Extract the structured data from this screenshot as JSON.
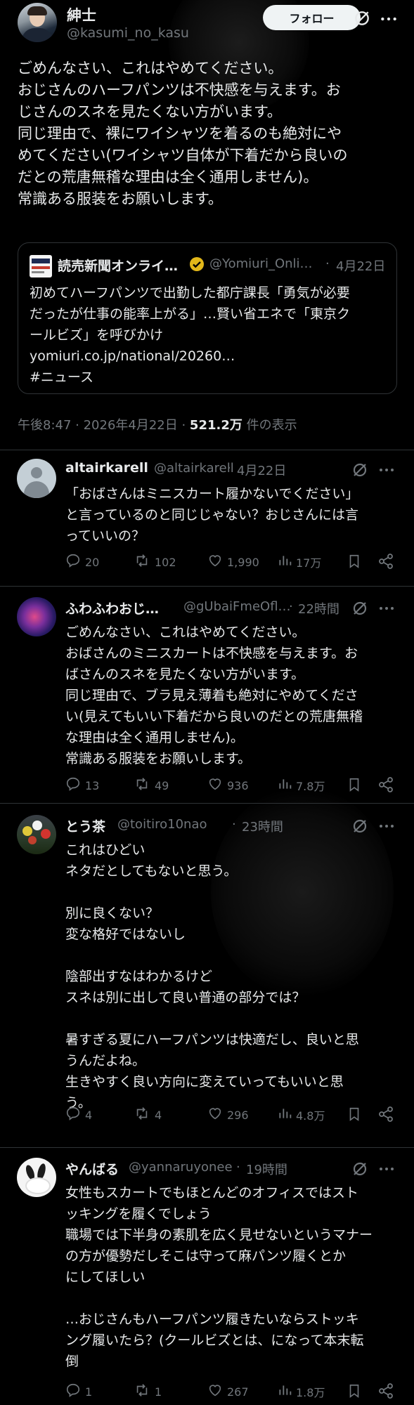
{
  "tweet": {
    "author_name": "紳士",
    "author_handle": "@kasumi_no_kasu",
    "follow_label": "フォロー",
    "text": "ごめんなさい、これはやめてください。\nおじさんのハーフパンツは不快感を与えます。お\nじさんのスネを見たくない方がいます。\n同じ理由で、裸にワイシャツを着るのも絶対にや\nめてください(ワイシャツ自体が下着だから良いの\nだとの荒唐無稽な理由は全く通用しません)。\n常識ある服装をお願いします。",
    "quote": {
      "source_name": "読売新聞オンライ…",
      "source_handle": "@Yomiuri_Onli…",
      "dot": "·",
      "date": "4月22日",
      "text": "初めてハーフパンツで出勤した都庁課長「勇気が必要\nだったが仕事の能率上がる」…賢い省エネで「東京ク\nールビズ」を呼びかけ\nyomiuri.co.jp/national/20260…\n#ニュース"
    },
    "timestamp": "午後8:47 · 2026年4月22日 · ",
    "views_count": "521.2万",
    "views_label": " 件の表示"
  },
  "replies": [
    {
      "name": "altairkarell",
      "handle": "@altairkarell",
      "dot": "·",
      "time": "4月22日",
      "text": "「おばさんはミニスカート履かないでください」\nと言っているのと同じじゃない？おじさんには言\nっていいの？",
      "replies_count": "20",
      "reposts_count": "102",
      "likes_count": "1,990",
      "views_count": "17万"
    },
    {
      "name": "ふわふわおじ…",
      "handle": "@gUbaiFmeOfl…",
      "dot": "·",
      "time": "22時間",
      "text": "ごめんなさい、これはやめてください。\nおばさんのミニスカートは不快感を与えます。お\nばさんのスネを見たくない方がいます。\n同じ理由で、ブラ見え薄着も絶対にやめてくださ\nい(見えてもいい下着だから良いのだとの荒唐無稽\nな理由は全く通用しません)。\n常識ある服装をお願いします。",
      "replies_count": "13",
      "reposts_count": "49",
      "likes_count": "936",
      "views_count": "7.8万"
    },
    {
      "name": "とう茶",
      "handle": "@toitiro10nao",
      "dot": "·",
      "time": "23時間",
      "text": "これはひどい\nネタだとしてもないと思う。\n\n別に良くない？\n変な格好ではないし\n\n陰部出すなはわかるけど\nスネは別に出して良い普通の部分では？\n\n暑すぎる夏にハーフパンツは快適だし、良いと思\nうんだよね。\n生きやすく良い方向に変えていってもいいと思\nう。",
      "replies_count": "4",
      "reposts_count": "4",
      "likes_count": "296",
      "views_count": "4.8万"
    },
    {
      "name": "やんばる",
      "handle": "@yannaruyonee",
      "dot": "·",
      "time": "19時間",
      "text": "女性もスカートでもほとんどのオフィスではスト\nッキングを履くでしょう\n職場では下半身の素肌を広く見せないというマナー\nの方が優勢だしそこは守って麻パンツ履くとか\nにしてほしい\n\n…おじさんもハーフパンツ履きたいならストッキ\nング履いたら？(クールビズとは、になって本末転\n倒",
      "replies_count": "1",
      "reposts_count": "1",
      "likes_count": "267",
      "views_count": "1.8万"
    }
  ],
  "icons": {
    "grok": "grok-icon",
    "more": "more-icon",
    "reply": "reply-icon",
    "repost": "repost-icon",
    "like": "like-icon",
    "views": "views-icon",
    "bookmark": "bookmark-icon",
    "share": "share-icon",
    "verified": "verified-badge-icon"
  },
  "colors": {
    "background": "#000000",
    "text": "#e7e9ea",
    "secondary": "#71767b",
    "border": "#2f3336",
    "verified": "#e2b719"
  }
}
